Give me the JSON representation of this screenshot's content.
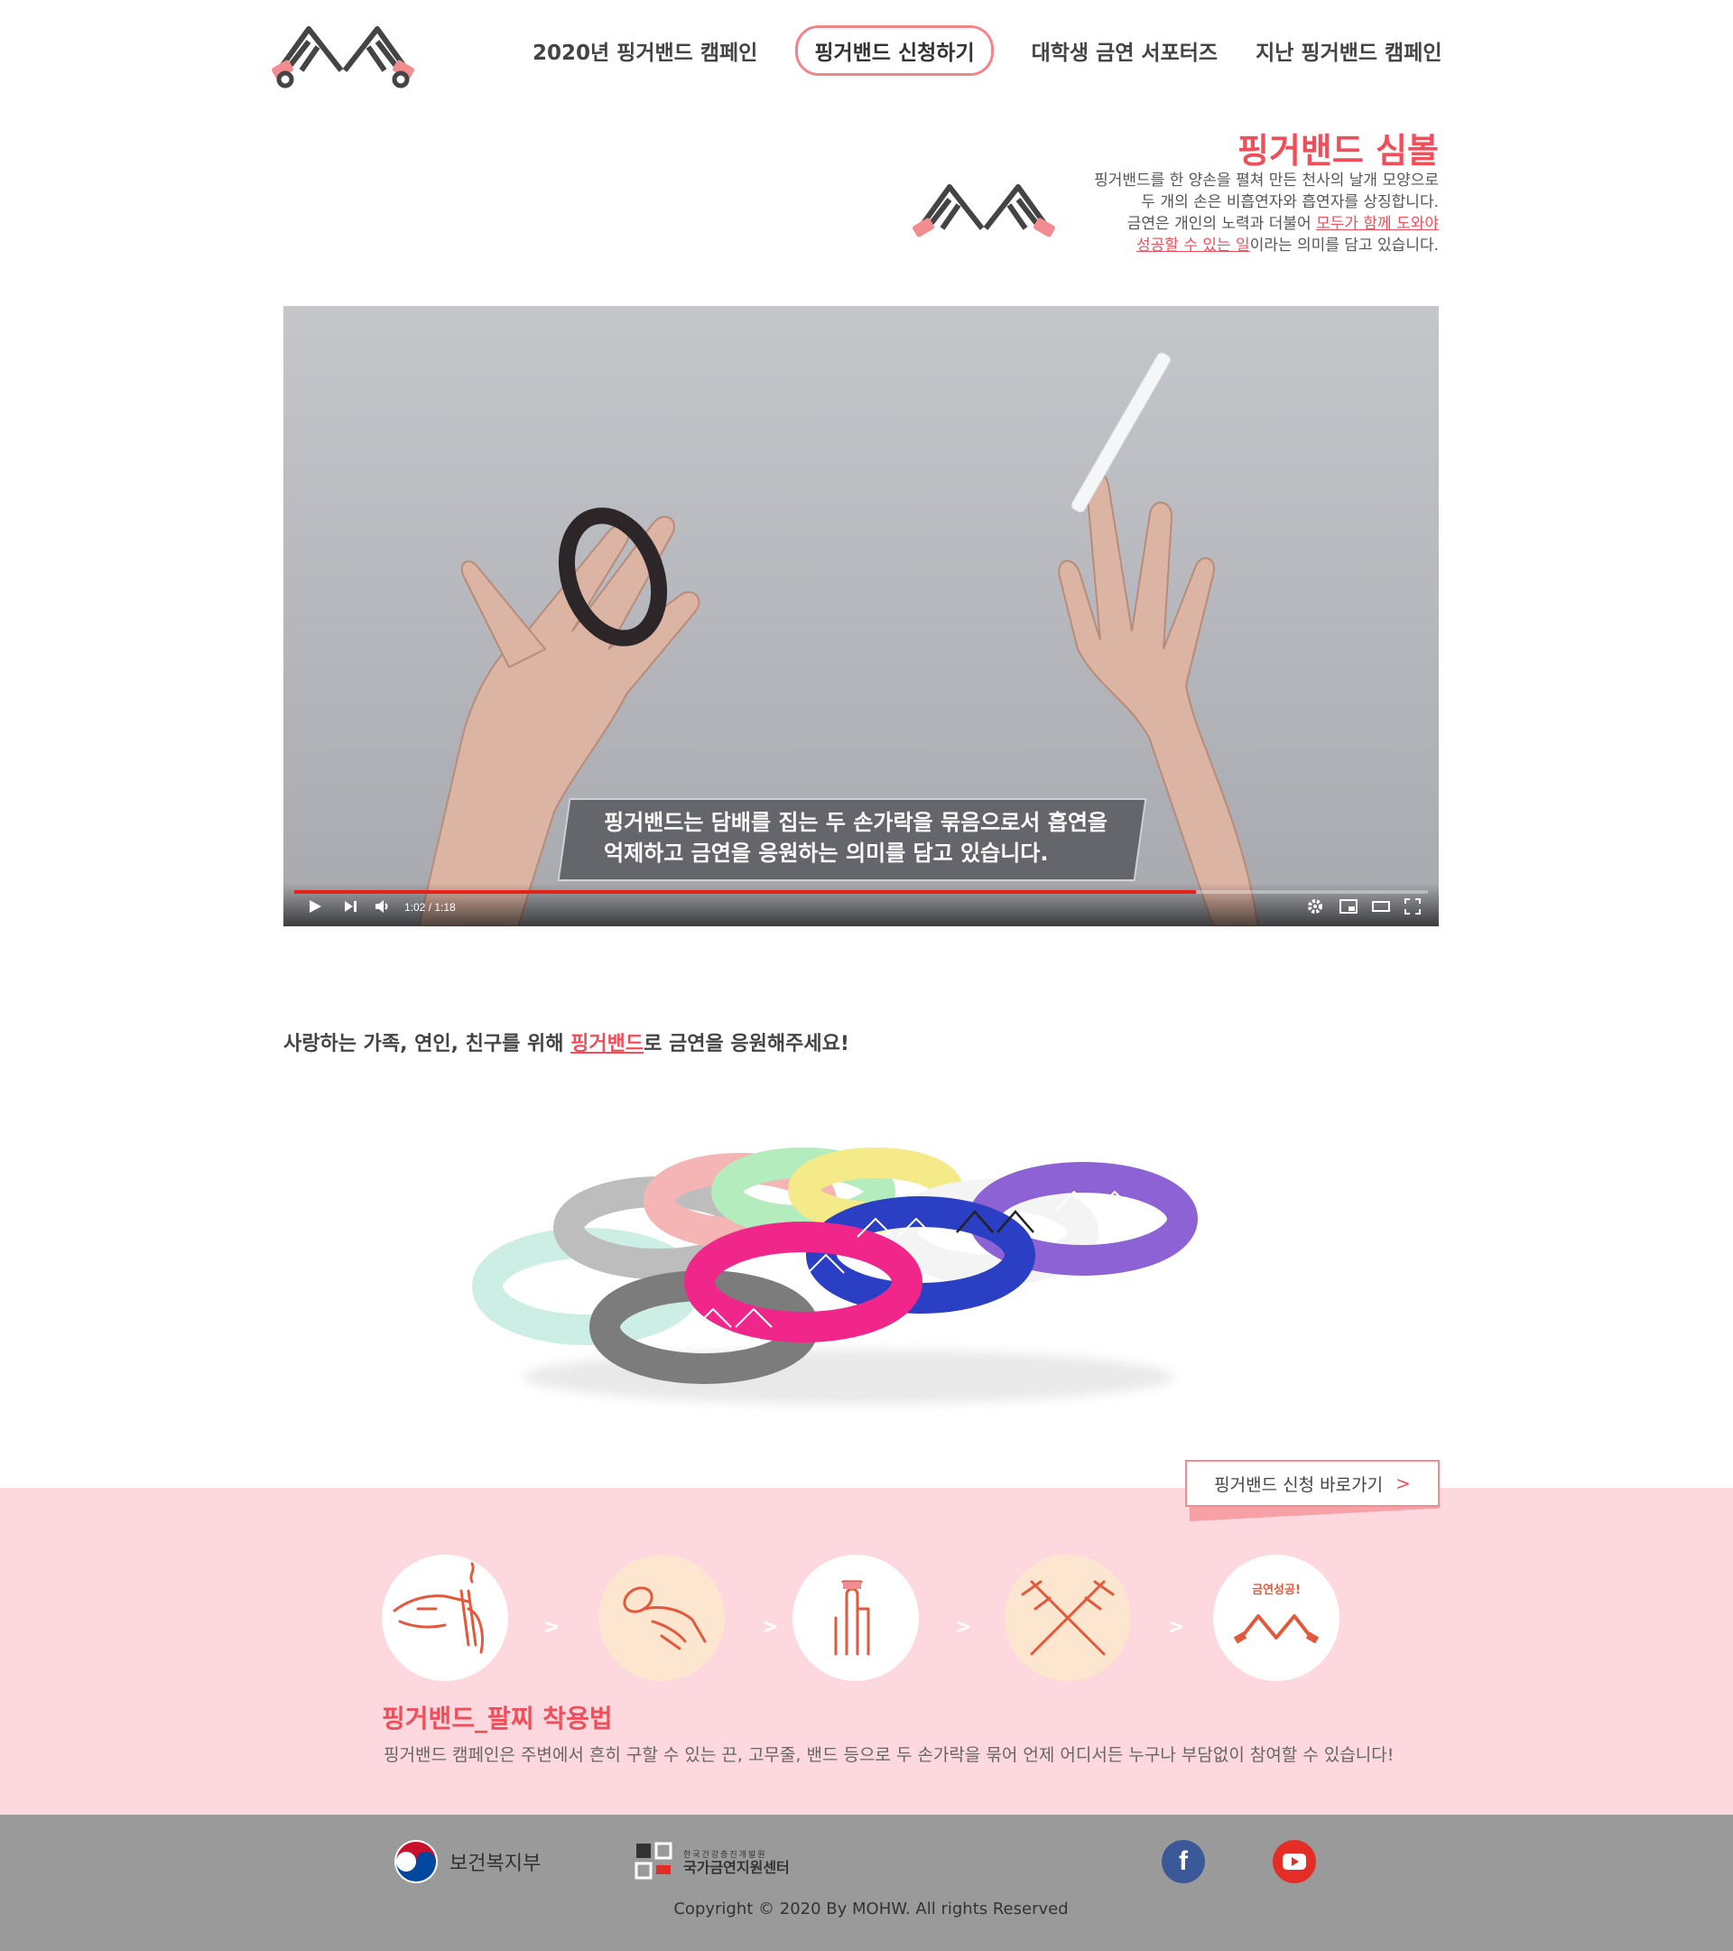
{
  "nav": {
    "items": [
      "2020년 핑거밴드 캠페인",
      "핑거밴드 신청하기",
      "대학생 금연 서포터즈",
      "지난 핑거밴드 캠페인"
    ],
    "active_index": 1
  },
  "symbol": {
    "title": "핑거밴드 심볼",
    "line1": "핑거밴드를 한 양손을 펼쳐 만든 천사의 날개 모양으로",
    "line2": "두 개의 손은 비흡연자와 흡연자를 상징합니다.",
    "line3_pre": "금연은 개인의 노력과 더불어 ",
    "line3_hl": "모두가 함께 도와야",
    "line4_hl": "성공할 수 있는 일",
    "line4_post": "이라는 의미를 담고 있습니다."
  },
  "video": {
    "caption_hl": "핑거밴드",
    "caption_line1": "는 담배를 집는 두 손가락을 묶음으로서 흡연을",
    "caption_line2": "억제하고 금연을 응원하는 의미를 담고 있습니다.",
    "time": "1:02 / 1:18",
    "progress": 0.795
  },
  "tagline": {
    "pre": "사랑하는 가족, 연인, 친구를 위해 ",
    "hl": "핑거밴드",
    "post": "로 금연을 응원해주세요!"
  },
  "apply_button": {
    "label": "핑거밴드 신청 바로가기",
    "chevron": ">"
  },
  "howto": {
    "title": "핑거밴드_팔찌 착용법",
    "desc": "핑거밴드 캠페인은 주변에서 흔히 구할 수 있는 끈, 고무줄, 밴드 등으로 두 손가락을 묶어 언제 어디서든 누구나 부담없이 참여할 수 있습니다!",
    "step5_label": "금연성공!",
    "arrow": ">"
  },
  "footer": {
    "mohw": "보건복지부",
    "khp_small": "한국건강증진개발원",
    "khp_big": "국가금연지원센터",
    "copyright": "Copyright © 2020 By MOHW. All rights Reserved",
    "facebook": "f"
  },
  "colors": {
    "accent": "#ef4f5a",
    "pink_bg": "#fdd8de",
    "footer_bg": "#9a9a9a"
  }
}
